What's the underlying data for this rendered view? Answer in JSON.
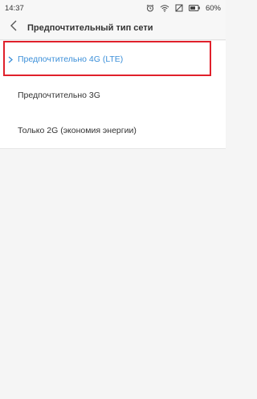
{
  "status_bar": {
    "time": "14:37",
    "battery_percent": "60%",
    "icons": [
      "alarm-icon",
      "wifi-icon",
      "mute-icon",
      "battery-icon"
    ]
  },
  "header": {
    "title": "Предпочтительный тип сети",
    "back_icon": "chevron-left-icon"
  },
  "options": [
    {
      "label": "Предпочтительно 4G (LTE)",
      "selected": true
    },
    {
      "label": "Предпочтительно 3G",
      "selected": false
    },
    {
      "label": "Только 2G (экономия энергии)",
      "selected": false
    }
  ],
  "colors": {
    "accent": "#3b8fd9",
    "highlight_border": "#e0202b",
    "background": "#f5f5f5"
  }
}
